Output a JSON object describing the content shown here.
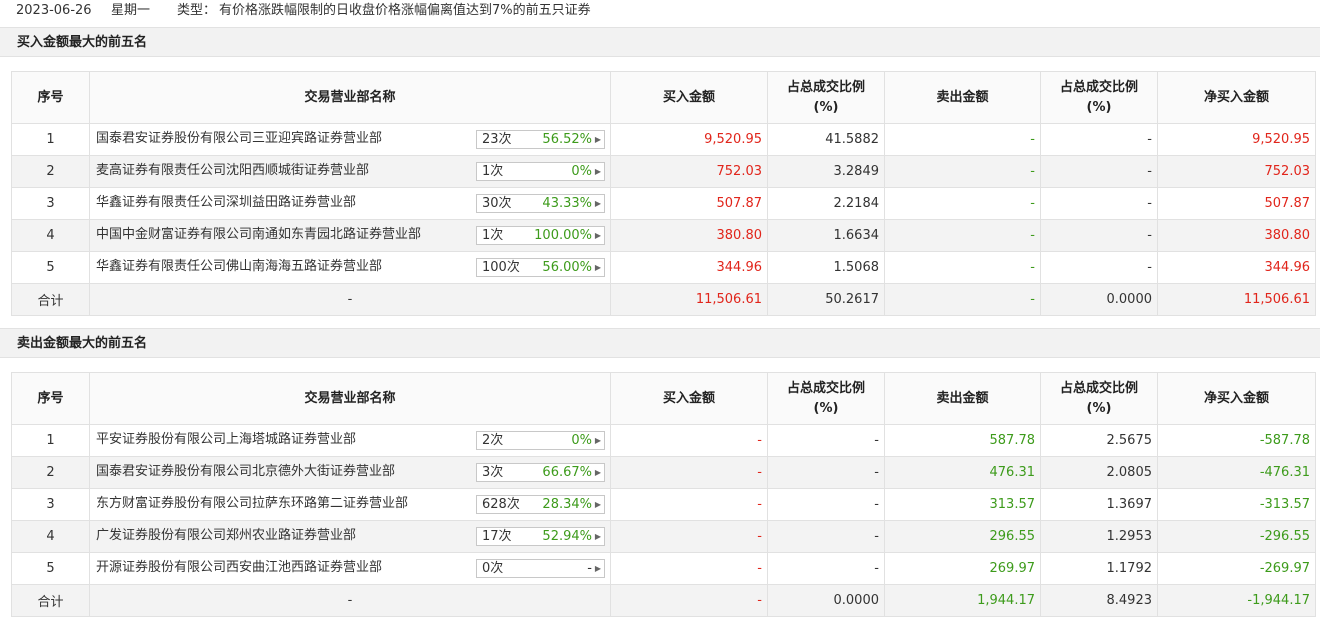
{
  "header": {
    "date": "2023-06-26",
    "weekday": "星期一",
    "type_label": "类型：",
    "type_text": "有价格涨跌幅限制的日收盘价格涨幅偏离值达到7%的前五只证券"
  },
  "columns": {
    "rank": "序号",
    "name": "交易营业部名称",
    "buy": "买入金额",
    "buy_pct_l1": "占总成交比例",
    "buy_pct_l2": "(%)",
    "sell": "卖出金额",
    "sell_pct_l1": "占总成交比例",
    "sell_pct_l2": "(%)",
    "net": "净买入金额"
  },
  "buy_section": {
    "title": "买入金额最大的前五名",
    "rows": [
      {
        "rank": "1",
        "name": "国泰君安证券股份有限公司三亚迎宾路证券营业部",
        "times": "23次",
        "rate": "56.52%",
        "buy": "9,520.95",
        "buy_pct": "41.5882",
        "sell": "-",
        "sell_pct": "-",
        "net": "9,520.95"
      },
      {
        "rank": "2",
        "name": "麦高证券有限责任公司沈阳西顺城街证券营业部",
        "times": "1次",
        "rate": "0%",
        "buy": "752.03",
        "buy_pct": "3.2849",
        "sell": "-",
        "sell_pct": "-",
        "net": "752.03"
      },
      {
        "rank": "3",
        "name": "华鑫证券有限责任公司深圳益田路证券营业部",
        "times": "30次",
        "rate": "43.33%",
        "buy": "507.87",
        "buy_pct": "2.2184",
        "sell": "-",
        "sell_pct": "-",
        "net": "507.87"
      },
      {
        "rank": "4",
        "name": "中国中金财富证券有限公司南通如东青园北路证券营业部",
        "times": "1次",
        "rate": "100.00%",
        "buy": "380.80",
        "buy_pct": "1.6634",
        "sell": "-",
        "sell_pct": "-",
        "net": "380.80"
      },
      {
        "rank": "5",
        "name": "华鑫证券有限责任公司佛山南海海五路证券营业部",
        "times": "100次",
        "rate": "56.00%",
        "buy": "344.96",
        "buy_pct": "1.5068",
        "sell": "-",
        "sell_pct": "-",
        "net": "344.96"
      }
    ],
    "total": {
      "label": "合计",
      "name": "-",
      "buy": "11,506.61",
      "buy_pct": "50.2617",
      "sell": "-",
      "sell_pct": "0.0000",
      "net": "11,506.61"
    }
  },
  "sell_section": {
    "title": "卖出金额最大的前五名",
    "rows": [
      {
        "rank": "1",
        "name": "平安证券股份有限公司上海塔城路证券营业部",
        "times": "2次",
        "rate": "0%",
        "buy": "-",
        "buy_pct": "-",
        "sell": "587.78",
        "sell_pct": "2.5675",
        "net": "-587.78"
      },
      {
        "rank": "2",
        "name": "国泰君安证券股份有限公司北京德外大街证券营业部",
        "times": "3次",
        "rate": "66.67%",
        "buy": "-",
        "buy_pct": "-",
        "sell": "476.31",
        "sell_pct": "2.0805",
        "net": "-476.31"
      },
      {
        "rank": "3",
        "name": "东方财富证券股份有限公司拉萨东环路第二证券营业部",
        "times": "628次",
        "rate": "28.34%",
        "buy": "-",
        "buy_pct": "-",
        "sell": "313.57",
        "sell_pct": "1.3697",
        "net": "-313.57"
      },
      {
        "rank": "4",
        "name": "广发证券股份有限公司郑州农业路证券营业部",
        "times": "17次",
        "rate": "52.94%",
        "buy": "-",
        "buy_pct": "-",
        "sell": "296.55",
        "sell_pct": "1.2953",
        "net": "-296.55"
      },
      {
        "rank": "5",
        "name": "开源证券股份有限公司西安曲江池西路证券营业部",
        "times": "0次",
        "rate": "-",
        "buy": "-",
        "buy_pct": "-",
        "sell": "269.97",
        "sell_pct": "1.1792",
        "net": "-269.97"
      }
    ],
    "total": {
      "label": "合计",
      "name": "-",
      "buy": "-",
      "buy_pct": "0.0000",
      "sell": "1,944.17",
      "sell_pct": "8.4923",
      "net": "-1,944.17"
    }
  },
  "colors": {
    "up": "#e1251b",
    "down": "#3d9b1b",
    "pill_arrow": "#666666"
  },
  "icons": {
    "pill_arrow": "caret-right-icon"
  }
}
